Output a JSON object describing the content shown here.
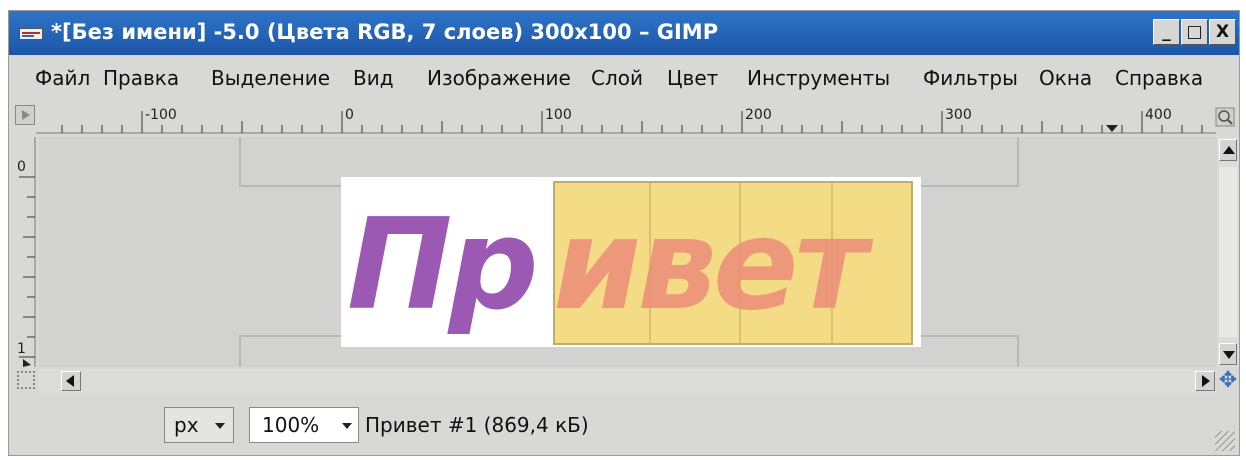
{
  "window": {
    "title": "*[Без имени] -5.0 (Цвета RGB, 7 слоев) 300x100 – GIMP",
    "buttons": {
      "minimize": "_",
      "maximize": "□",
      "close": "X"
    }
  },
  "menu": {
    "items": [
      {
        "label": "Файл"
      },
      {
        "label": "Правка"
      },
      {
        "label": "Выделение"
      },
      {
        "label": "Вид"
      },
      {
        "label": "Изображение"
      },
      {
        "label": "Слой"
      },
      {
        "label": "Цвет"
      },
      {
        "label": "Инструменты"
      },
      {
        "label": "Фильтры"
      },
      {
        "label": "Окна"
      },
      {
        "label": "Справка"
      }
    ]
  },
  "rulers": {
    "horizontal_labels": [
      "-100",
      "0",
      "100",
      "200",
      "300",
      "400"
    ],
    "vertical_labels": [
      "0",
      "1"
    ]
  },
  "canvas": {
    "text_part1": "Пр",
    "text_part2": "ивет",
    "colors": {
      "text": "#9b59b3",
      "layer": "#f3dc85",
      "overlay_text": "#eb8c78"
    }
  },
  "status": {
    "unit": "px",
    "zoom": "100%",
    "info": "Привет #1 (869,4 кБ)"
  },
  "icons": {
    "app": "gimp-window-icon",
    "navigate": "navigate-icon",
    "zoom": "zoom-icon"
  }
}
